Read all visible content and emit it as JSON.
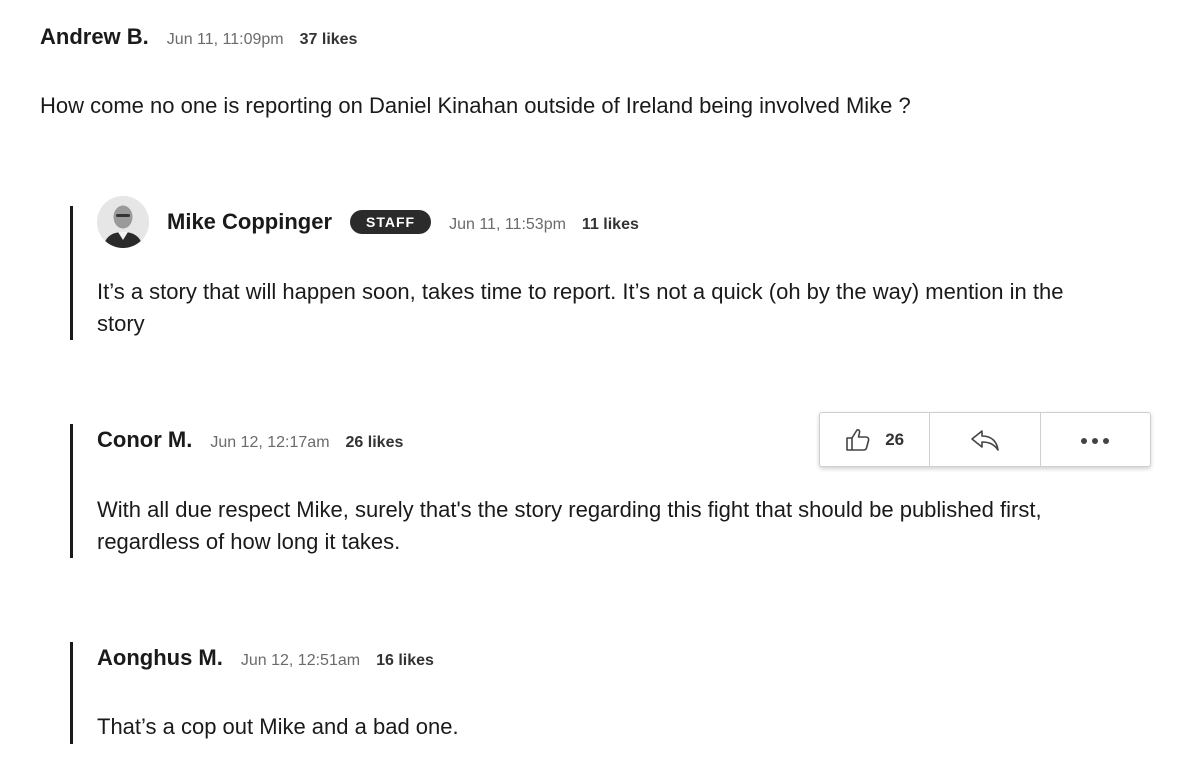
{
  "comments": [
    {
      "author": "Andrew B.",
      "timestamp": "Jun 11, 11:09pm",
      "likes": "37 likes",
      "body": "How come no one is reporting on Daniel Kinahan outside of Ireland being involved Mike ?"
    },
    {
      "author": "Mike Coppinger",
      "badge": "STAFF",
      "timestamp": "Jun 11, 11:53pm",
      "likes": "11 likes",
      "body": "It’s a story that will happen soon, takes time to report. It’s not a quick (oh by the way) mention in the story"
    },
    {
      "author": "Conor M.",
      "timestamp": "Jun 12, 12:17am",
      "likes": "26 likes",
      "body": "With all due respect Mike, surely that's the story regarding this fight that should be published first, regardless of how long it takes."
    },
    {
      "author": "Aonghus M.",
      "timestamp": "Jun 12, 12:51am",
      "likes": "16 likes",
      "body": "That’s a cop out Mike and a bad one."
    }
  ],
  "action_bar": {
    "like_count": "26",
    "icons": [
      "thumbs-up-icon",
      "reply-icon",
      "more-icon"
    ]
  }
}
